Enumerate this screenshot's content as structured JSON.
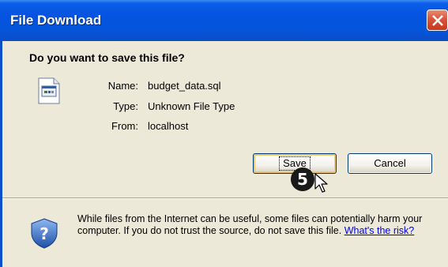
{
  "window": {
    "title": "File Download"
  },
  "dialog": {
    "question": "Do you want to save this file?",
    "info": [
      {
        "label": "Name:",
        "value": "budget_data.sql"
      },
      {
        "label": "Type:",
        "value": "Unknown File Type"
      },
      {
        "label": "From:",
        "value": "localhost"
      }
    ],
    "buttons": {
      "save_label": "Save",
      "cancel_label": "Cancel"
    },
    "step_number": "5",
    "warning": "While files from the Internet can be useful, some files can potentially harm your computer. If you do not trust the source, do not save this file.",
    "risk_link": "What's the risk?"
  },
  "colors": {
    "titlebar": "#0553e0",
    "close_button": "#d8553b",
    "dialog_bg": "#ece9d8",
    "link": "#0000ee"
  },
  "icons": {
    "close": "close-icon",
    "file": "file-icon",
    "shield": "shield-question-icon",
    "cursor": "mouse-pointer-icon"
  }
}
